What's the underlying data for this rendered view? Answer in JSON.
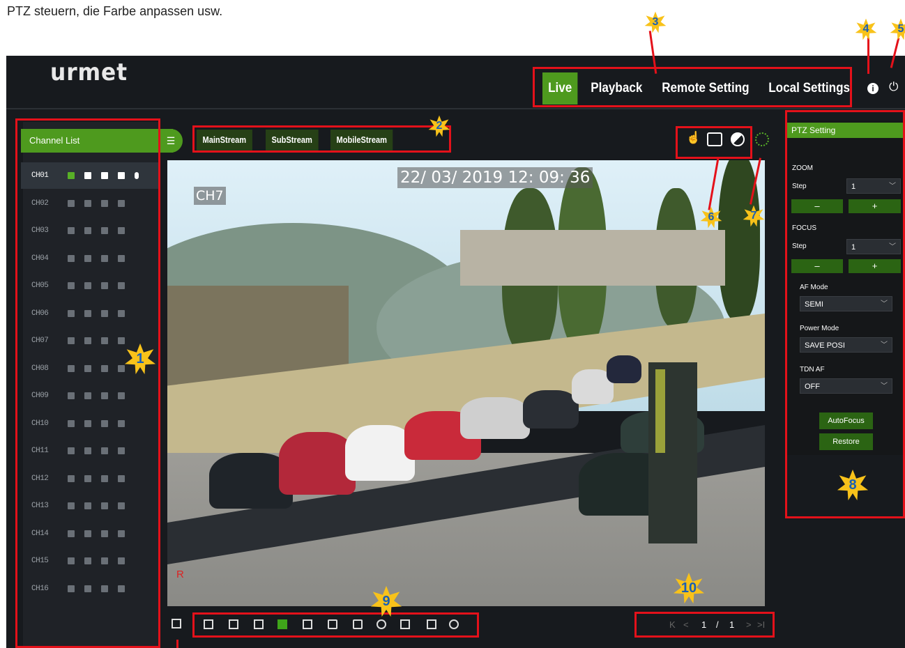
{
  "caption": "PTZ steuern, die Farbe anpassen usw.",
  "logo": "urmet",
  "nav": {
    "live": "Live",
    "playback": "Playback",
    "remote": "Remote Setting",
    "local": "Local Settings"
  },
  "topicons": {
    "info": "i",
    "power": "⏻"
  },
  "sidebar": {
    "header": "Channel List",
    "channels": [
      "CH01",
      "CH02",
      "CH03",
      "CH04",
      "CH05",
      "CH06",
      "CH07",
      "CH08",
      "CH09",
      "CH10",
      "CH11",
      "CH12",
      "CH13",
      "CH14",
      "CH15",
      "CH16"
    ]
  },
  "streams": [
    "MainStream",
    "SubStream",
    "MobileStream"
  ],
  "video": {
    "datetime": "22/ 03/ 2019  12: 09: 36",
    "channel": "CH7",
    "rec": "R"
  },
  "ptz": {
    "title": "PTZ Setting",
    "zoom_label": "ZOOM",
    "focus_label": "FOCUS",
    "step_label": "Step",
    "zoom_step": "1",
    "focus_step": "1",
    "minus": "–",
    "plus": "+",
    "af_mode_label": "AF Mode",
    "af_mode": "SEMI",
    "power_mode_label": "Power Mode",
    "power_mode": "SAVE POSI",
    "tdn_label": "TDN AF",
    "tdn": "OFF",
    "autofocus": "AutoFocus",
    "restore": "Restore"
  },
  "pager": {
    "first": "K",
    "prev": "<",
    "current": "1",
    "sep": "/",
    "total": "1",
    "next": ">",
    "last": ">I"
  },
  "badges": [
    "1",
    "2",
    "3",
    "4",
    "5",
    "6",
    "7",
    "8",
    "9",
    "10"
  ],
  "colors": {
    "accent": "#4e9a1e",
    "annotation_red": "#e4111a",
    "badge_yellow": "#f8c21a",
    "badge_text": "#1a5fb4"
  }
}
